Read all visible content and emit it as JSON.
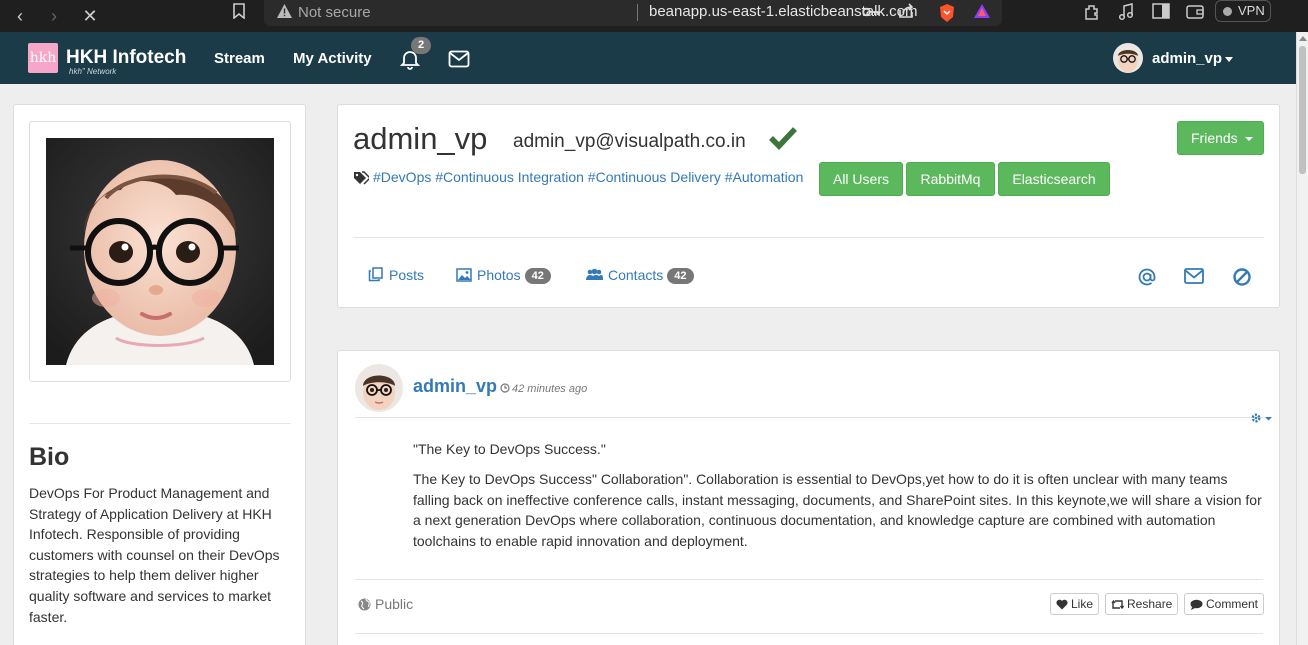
{
  "browser": {
    "security_label": "Not secure",
    "url": "beanapp.us-east-1.elasticbeanstalk.com",
    "vpn_label": "VPN"
  },
  "navbar": {
    "logo_text": "hkh",
    "brand": "HKH Infotech",
    "brand_sub": "hkh\" Network",
    "links": [
      "Stream",
      "My Activity"
    ],
    "notification_count": "2",
    "username": "admin_vp"
  },
  "profile": {
    "name": "admin_vp",
    "email": "admin_vp@visualpath.co.in",
    "tags": "#DevOps #Continuous Integration #Continuous Delivery #Automation",
    "buttons": [
      "All Users",
      "RabbitMq",
      "Elasticsearch"
    ],
    "friends_label": "Friends",
    "tabs": {
      "posts": "Posts",
      "photos": "Photos",
      "photos_count": "42",
      "contacts": "Contacts",
      "contacts_count": "42"
    }
  },
  "bio": {
    "title": "Bio",
    "text": "DevOps For Product Management and Strategy of Application Delivery at HKH Infotech. Responsible of providing customers with counsel on their DevOps strategies to help them deliver higher quality software and services to market faster."
  },
  "post": {
    "author": "admin_vp",
    "time": "42 minutes ago",
    "title": "\"The Key to DevOps Success.\"",
    "body": "The Key to DevOps Success\" Collaboration\". Collaboration is essential to DevOps,yet how to do it is often unclear with many teams falling back on ineffective conference calls, instant messaging, documents, and SharePoint sites. In this keynote,we will share a vision for a next generation DevOps where collaboration, continuous documentation, and knowledge capture are combined with automation toolchains to enable rapid innovation and deployment.",
    "visibility": "Public",
    "actions": [
      "Like",
      "Reshare",
      "Comment"
    ]
  },
  "colors": {
    "navbar": "#1a3b47",
    "link": "#337ab7",
    "success": "#5cb85c",
    "badge": "#777777",
    "check": "#3c763d"
  }
}
